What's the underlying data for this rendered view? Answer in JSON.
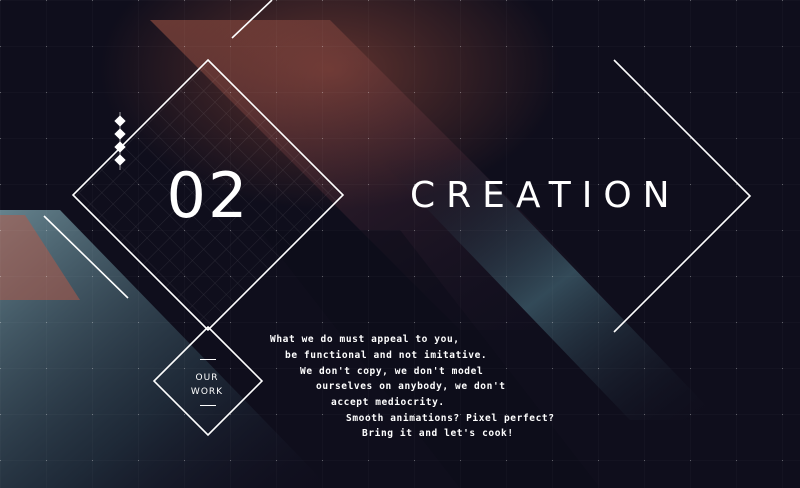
{
  "section": {
    "number": "02",
    "title": "CREATION"
  },
  "work_button": {
    "line1": "OUR",
    "line2": "WORK"
  },
  "description": {
    "lines": [
      "What we do must appeal to you,",
      "be functional and not imitative.",
      "We don't copy, we don't model",
      "ourselves on anybody, we don't",
      "accept mediocrity.",
      "Smooth animations? Pixel perfect?",
      "Bring it and let's cook!"
    ]
  },
  "icons": {
    "next_arrow": "chevron-right-icon",
    "dots": "diamond-dots-icon"
  },
  "colors": {
    "background": "#0f0e1c",
    "accent_copper": "#b45a46",
    "accent_teal": "#5a8c9a",
    "text": "#ffffff"
  }
}
